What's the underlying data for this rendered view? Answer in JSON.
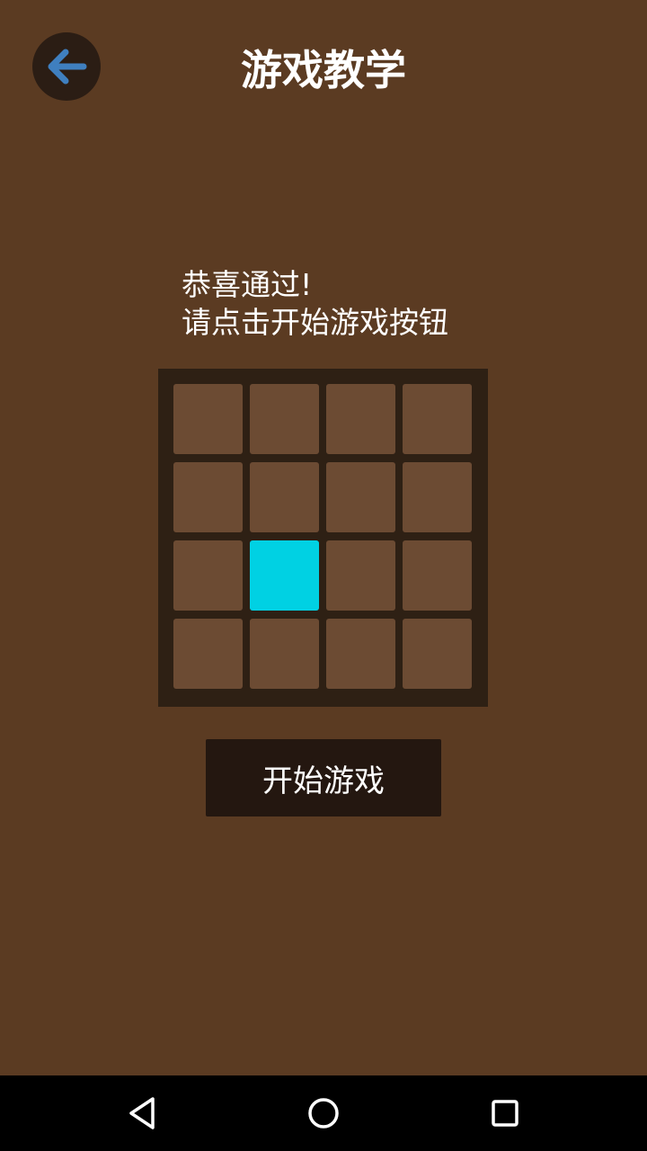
{
  "header": {
    "title": "游戏教学",
    "back_icon": "arrow-left-icon",
    "accent_color": "#3f7fbf"
  },
  "tutorial": {
    "line1": "恭喜通过!",
    "line2": "请点击开始游戏按钮"
  },
  "board": {
    "rows": 4,
    "cols": 4,
    "active_cell": {
      "row": 3,
      "col": 2
    },
    "active_color": "#00d1e3",
    "cell_color": "#6c4b33"
  },
  "start_button": {
    "label": "开始游戏"
  },
  "system_nav": {
    "back": "triangle-back-icon",
    "home": "circle-home-icon",
    "recent": "square-recent-icon"
  }
}
